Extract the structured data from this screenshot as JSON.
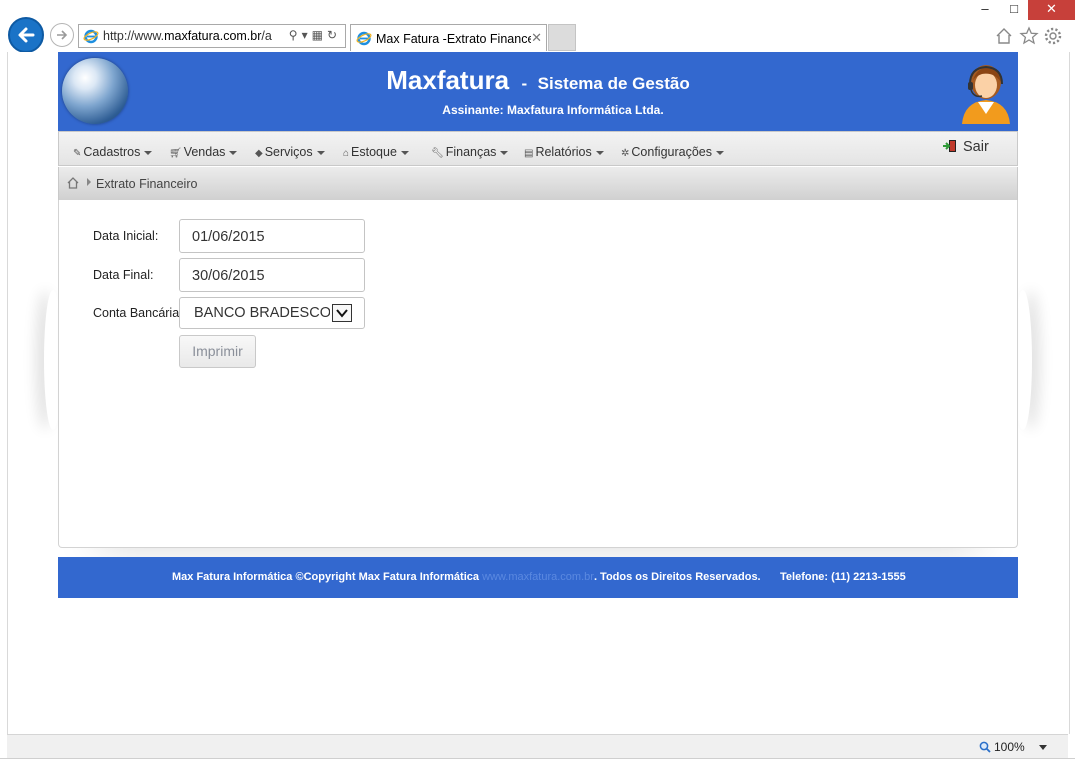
{
  "browser": {
    "url_prefix": "http://www.",
    "url_domain": "maxfatura.com.br",
    "url_rest": "/a",
    "tab_title": "Max Fatura -Extrato Finance...",
    "tab_close": "✕",
    "window_controls": {
      "minimize": "–",
      "maximize": "□",
      "close": "✕"
    },
    "zoom": "100%"
  },
  "header": {
    "app_name": "Maxfatura",
    "dash": "-",
    "subtitle": "Sistema de Gestão",
    "subscriber": "Assinante: Maxfatura Informática Ltda.",
    "bg_color": "#3368cf"
  },
  "nav": {
    "items": [
      {
        "label": "Cadastros",
        "icon": "pencil-icon"
      },
      {
        "label": "Vendas",
        "icon": "cart-icon"
      },
      {
        "label": "Serviços",
        "icon": "tag-icon"
      },
      {
        "label": "Estoque",
        "icon": "home-icon"
      },
      {
        "label": "Finanças",
        "icon": "wrench-icon"
      },
      {
        "label": "Relatórios",
        "icon": "print-icon"
      },
      {
        "label": "Configurações",
        "icon": "gear-icon"
      }
    ],
    "logout": "Sair"
  },
  "breadcrumb": {
    "current": "Extrato Financeiro"
  },
  "form": {
    "start_label": "Data Inicial:",
    "start_value": "01/06/2015",
    "end_label": "Data Final:",
    "end_value": "30/06/2015",
    "account_label": "Conta Bancária:",
    "account_value": "BANCO BRADESCO S",
    "print_label": "Imprimir"
  },
  "footer": {
    "copyright": "Max Fatura Informática ©Copyright Max Fatura Informática",
    "site": "www.maxfatura.com.br",
    "rights": ". Todos os Direitos Reservados.",
    "phone": "Telefone: (11) 2213-1555"
  }
}
